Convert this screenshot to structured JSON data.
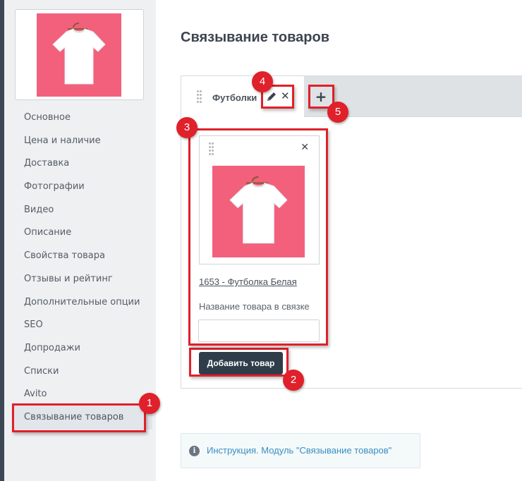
{
  "sidebar": {
    "items": [
      {
        "label": "Основное"
      },
      {
        "label": "Цена и наличие"
      },
      {
        "label": "Доставка"
      },
      {
        "label": "Фотографии"
      },
      {
        "label": "Видео"
      },
      {
        "label": "Описание"
      },
      {
        "label": "Свойства товара"
      },
      {
        "label": "Отзывы и рейтинг"
      },
      {
        "label": "Дополнительные опции"
      },
      {
        "label": "SEO"
      },
      {
        "label": "Допродажи"
      },
      {
        "label": "Списки"
      },
      {
        "label": "Avito"
      },
      {
        "label": "Связывание товаров"
      }
    ],
    "active_index": 13
  },
  "page": {
    "title": "Связывание товаров"
  },
  "tabs": [
    {
      "label": "Футболки"
    }
  ],
  "product": {
    "link": "1653 - Футболка Белая",
    "name_label": "Название товара в связке",
    "name_value": ""
  },
  "buttons": {
    "add_product": "Добавить товар",
    "add_tab_symbol": "+",
    "close_symbol": "✕"
  },
  "info": {
    "icon": "i",
    "text": "Инструкция. Модуль \"Связывание товаров\""
  },
  "callouts": [
    "1",
    "2",
    "3",
    "4",
    "5"
  ],
  "colors": {
    "accent_red": "#e0202a",
    "button_dark": "#2f3d4a",
    "product_bg": "#f2607c",
    "link_blue": "#3a8fc2"
  },
  "icons": [
    "drag-handle-icon",
    "pencil-icon",
    "close-icon",
    "plus-icon",
    "info-icon",
    "tshirt-image"
  ]
}
